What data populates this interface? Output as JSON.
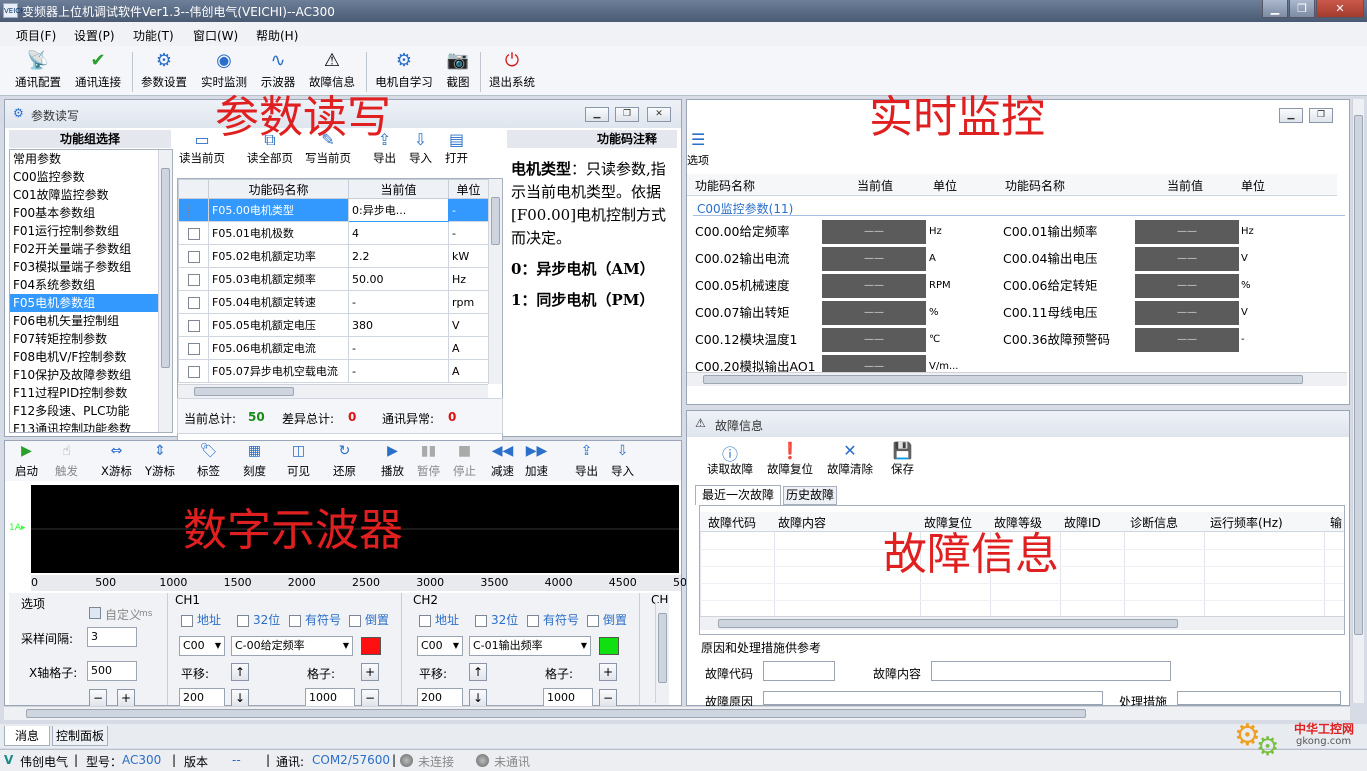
{
  "window": {
    "title": "变频器上位机调试软件Ver1.3--伟创电气(VEICHI)--AC300",
    "app_icon_text": "VEICHI"
  },
  "menu": [
    "项目(F)",
    "设置(P)",
    "功能(T)",
    "窗口(W)",
    "帮助(H)"
  ],
  "toolbar": [
    {
      "label": "通讯配置",
      "icon": "satellite-icon"
    },
    {
      "label": "通讯连接",
      "icon": "check-icon"
    },
    {
      "label": "参数设置",
      "icon": "gear-icon"
    },
    {
      "label": "实时监测",
      "icon": "eye-icon"
    },
    {
      "label": "示波器",
      "icon": "waveform-icon"
    },
    {
      "label": "故障信息",
      "icon": "warning-icon"
    },
    {
      "label": "电机自学习",
      "icon": "motor-icon"
    },
    {
      "label": "截图",
      "icon": "camera-icon"
    },
    {
      "label": "退出系统",
      "icon": "power-icon"
    }
  ],
  "param_panel": {
    "title": "参数读写",
    "overlay": "参数读写",
    "group_header": "功能组选择",
    "groups": [
      "常用参数",
      "C00监控参数",
      "C01故障监控参数",
      "F00基本参数组",
      "F01运行控制参数组",
      "F02开关量端子参数组",
      "F03模拟量端子参数组",
      "F04系统参数组",
      "F05电机参数组",
      "F06电机矢量控制组",
      "F07转矩控制参数",
      "F08电机V/F控制参数",
      "F10保护及故障参数组",
      "F11过程PID控制参数",
      "F12多段速、PLC功能",
      "F13通讯控制功能参数"
    ],
    "selected_group": "F05电机参数组",
    "actions": [
      "读当前页",
      "读全部页",
      "写当前页",
      "导出",
      "导入",
      "打开"
    ],
    "columns": [
      "功能码名称",
      "当前值",
      "单位"
    ],
    "rows": [
      [
        "F05.00电机类型",
        "0:异步电...",
        "-"
      ],
      [
        "F05.01电机极数",
        "4",
        "-"
      ],
      [
        "F05.02电机额定功率",
        "2.2",
        "kW"
      ],
      [
        "F05.03电机额定频率",
        "50.00",
        "Hz"
      ],
      [
        "F05.04电机额定转速",
        "-",
        "rpm"
      ],
      [
        "F05.05电机额定电压",
        "380",
        "V"
      ],
      [
        "F05.06电机额定电流",
        "-",
        "A"
      ],
      [
        "F05.07异步电机空载电流",
        "-",
        "A"
      ]
    ],
    "note_header": "功能码注释",
    "note_title": "电机类型",
    "note_body": "：只读参数,指示当前电机类型。依据[F00.00]电机控制方式而决定。",
    "note_opt0": "0：异步电机（AM）",
    "note_opt1": "1：同步电机（PM）",
    "totals": {
      "total_label": "当前总计:",
      "total": "50",
      "diff_label": "差异总计:",
      "diff": "0",
      "err_label": "通讯异常:",
      "err": "0"
    }
  },
  "scope": {
    "overlay": "数字示波器",
    "tools": [
      "启动",
      "触发",
      "X游标",
      "Y游标",
      "标签",
      "刻度",
      "可见",
      "还原",
      "播放",
      "暂停",
      "停止",
      "减速",
      "加速",
      "导出",
      "导入"
    ],
    "xticks": [
      "0",
      "500",
      "1000",
      "1500",
      "2000",
      "2500",
      "3000",
      "3500",
      "4000",
      "4500",
      "50"
    ],
    "options_label": "选项",
    "custom_label": "自定义",
    "custom_unit": "ms",
    "sample_label": "采样间隔:",
    "sample": "3",
    "xgrid_label": "X轴格子:",
    "xgrid": "500",
    "ch1": {
      "name": "CH1",
      "code": "C00",
      "signal": "C-00给定频率",
      "color": "#ff1010",
      "offset": "200",
      "grid": "1000"
    },
    "ch2": {
      "name": "CH2",
      "code": "C00",
      "signal": "C-01输出频率",
      "color": "#10e010",
      "offset": "200",
      "grid": "1000"
    },
    "ch3": {
      "name": "CH"
    },
    "ch_opts": [
      "地址",
      "32位",
      "有符号",
      "倒置"
    ],
    "shift_label": "平移:",
    "grid_label": "格子:"
  },
  "monitor": {
    "overlay": "实时监控",
    "options_label": "选项",
    "columns": [
      "功能码名称",
      "当前值",
      "单位",
      "功能码名称",
      "当前值",
      "单位"
    ],
    "group": "C00监控参数(11)",
    "rows": [
      [
        "C00.00给定频率",
        "——",
        "Hz",
        "C00.01输出频率",
        "——",
        "Hz"
      ],
      [
        "C00.02输出电流",
        "——",
        "A",
        "C00.04输出电压",
        "——",
        "V"
      ],
      [
        "C00.05机械速度",
        "——",
        "RPM",
        "C00.06给定转矩",
        "——",
        "%"
      ],
      [
        "C00.07输出转矩",
        "——",
        "%",
        "C00.11母线电压",
        "——",
        "V"
      ],
      [
        "C00.12模块温度1",
        "——",
        "℃",
        "C00.36故障预警码",
        "——",
        "-"
      ],
      [
        "C00.20模拟输出AO1",
        "——",
        "V/m..."
      ]
    ]
  },
  "fault": {
    "title": "故障信息",
    "overlay": "故障信息",
    "actions": [
      "读取故障",
      "故障复位",
      "故障清除",
      "保存"
    ],
    "tabs": [
      "最近一次故障",
      "历史故障"
    ],
    "columns": [
      "故障代码",
      "故障内容",
      "故障复位",
      "故障等级",
      "故障ID",
      "诊断信息",
      "运行频率(Hz)",
      "输"
    ],
    "cause_header": "原因和处理措施供参考",
    "code_label": "故障代码",
    "content_label": "故障内容",
    "reason_label": "故障原因",
    "measure_label": "处理措施"
  },
  "bottom_tabs": [
    "消息",
    "控制面板"
  ],
  "status": {
    "company": "伟创电气",
    "model_label": "型号：",
    "model": "AC300",
    "version_label": "版本",
    "version": "--",
    "comm_label": "通讯:",
    "comm": "COM2/57600",
    "conn": "未连接",
    "comm_state": "未通讯"
  },
  "watermark": {
    "text": "中华工控网",
    "url": "gkong.com"
  }
}
